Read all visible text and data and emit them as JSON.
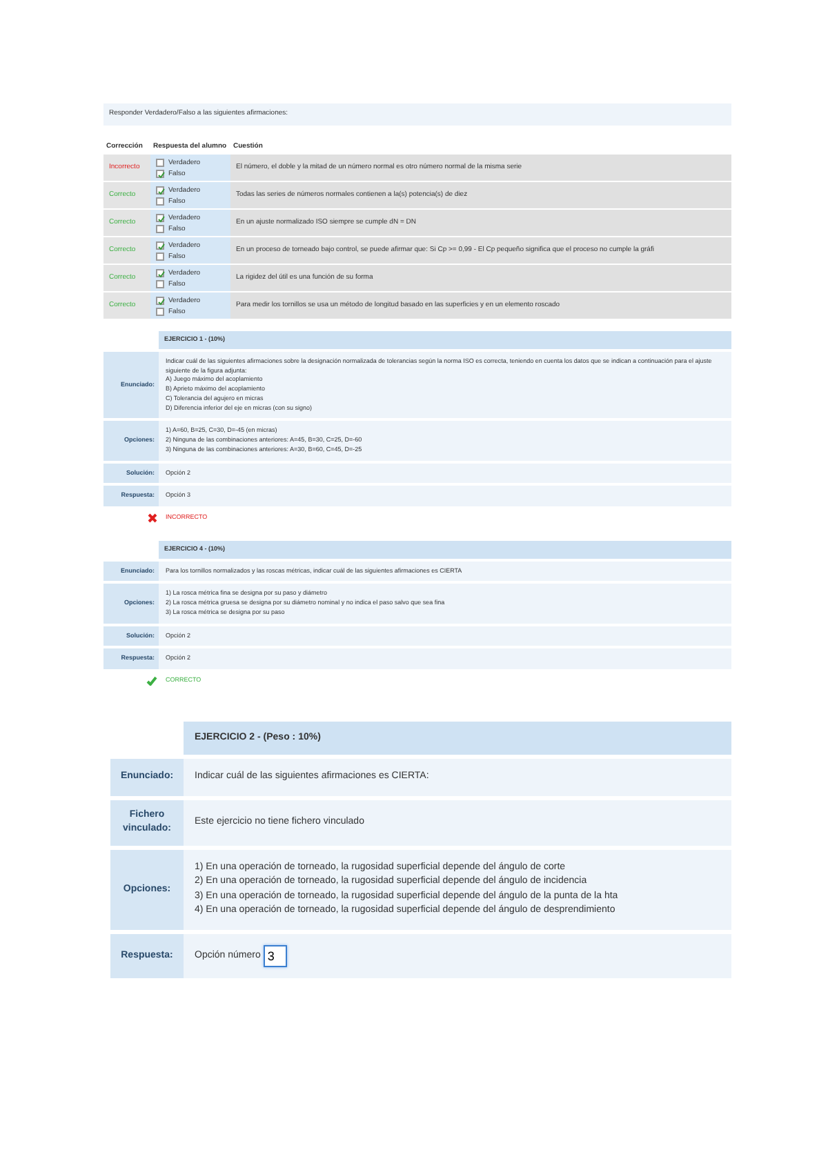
{
  "instruction": "Responder Verdadero/Falso a las siguientes afirmaciones:",
  "tf_table": {
    "columns": [
      "Corrección",
      "Respuesta del alumno",
      "Cuestión"
    ],
    "rows": [
      {
        "correction": "Incorrecto",
        "correct": false,
        "options": [
          {
            "label": "Verdadero",
            "checked": false
          },
          {
            "label": "Falso",
            "checked": true
          }
        ],
        "question": "El número, el doble y la mitad de un número normal es otro número normal de la misma serie"
      },
      {
        "correction": "Correcto",
        "correct": true,
        "options": [
          {
            "label": "Verdadero",
            "checked": true
          },
          {
            "label": "Falso",
            "checked": false
          }
        ],
        "question": "Todas las series de números normales contienen a la(s) potencia(s) de diez"
      },
      {
        "correction": "Correcto",
        "correct": true,
        "options": [
          {
            "label": "Verdadero",
            "checked": true
          },
          {
            "label": "Falso",
            "checked": false
          }
        ],
        "question": "En un ajuste normalizado ISO siempre se cumple dN = DN"
      },
      {
        "correction": "Correcto",
        "correct": true,
        "options": [
          {
            "label": "Verdadero",
            "checked": true
          },
          {
            "label": "Falso",
            "checked": false
          }
        ],
        "question": "En un proceso de torneado bajo control, se puede afirmar que: Si Cp >= 0,99 - El Cp pequeño significa que el proceso no cumple la gráfi"
      },
      {
        "correction": "Correcto",
        "correct": true,
        "options": [
          {
            "label": "Verdadero",
            "checked": true
          },
          {
            "label": "Falso",
            "checked": false
          }
        ],
        "question": "La rigidez del útil es una función de su forma"
      },
      {
        "correction": "Correcto",
        "correct": true,
        "options": [
          {
            "label": "Verdadero",
            "checked": true
          },
          {
            "label": "Falso",
            "checked": false
          }
        ],
        "question": "Para medir los tornillos se usa un método de longitud basado en las superficies y en un elemento roscado"
      }
    ]
  },
  "exercises": [
    {
      "kind": "review",
      "title": "EJERCICIO 1 - (10%)",
      "fields": [
        {
          "label": "Enunciado:",
          "kind": "text",
          "lines": [
            "Indicar cuál de las siguientes afirmaciones sobre la designación normalizada de tolerancias según la norma ISO es correcta, teniendo en cuenta los datos que se indican a continuación para el ajuste",
            "siguiente de la figura adjunta:",
            "A) Juego máximo del acoplamiento",
            "B) Aprieto máximo del acoplamiento",
            "C) Tolerancia del agujero en micras",
            "D) Diferencia inferior del eje en micras (con su signo)"
          ]
        },
        {
          "label": "Opciones:",
          "kind": "text",
          "lines": [
            "1) A=60, B=25, C=30, D=-45 (en micras)",
            "2) Ninguna de las combinaciones anteriores: A=45, B=30, C=25, D=-60",
            "3) Ninguna de las combinaciones anteriores: A=30, B=60, C=45, D=-25"
          ]
        },
        {
          "label": "Solución:",
          "kind": "text",
          "lines": [
            "Opción 2"
          ]
        },
        {
          "label": "Respuesta:",
          "kind": "text",
          "lines": [
            "Opción 3"
          ]
        }
      ],
      "result": {
        "text": "INCORRECTO",
        "correct": false
      }
    },
    {
      "kind": "review",
      "title": "EJERCICIO 4 - (10%)",
      "fields": [
        {
          "label": "Enunciado:",
          "kind": "text",
          "lines": [
            "Para los tornillos normalizados y las roscas métricas, indicar cuál de las siguientes afirmaciones es CIERTA"
          ]
        },
        {
          "label": "Opciones:",
          "kind": "text",
          "lines": [
            "1) La rosca métrica fina se designa por su paso y diámetro",
            "2) La rosca métrica gruesa se designa por su diámetro nominal y no indica el paso salvo que sea fina",
            "3) La rosca métrica se designa por su paso"
          ]
        },
        {
          "label": "Solución:",
          "kind": "text",
          "lines": [
            "Opción 2"
          ]
        },
        {
          "label": "Respuesta:",
          "kind": "text",
          "lines": [
            "Opción 2"
          ]
        }
      ],
      "result": {
        "text": "CORRECTO",
        "correct": true
      }
    },
    {
      "kind": "answer",
      "title": "EJERCICIO 2 - (Peso : 10%)",
      "fields": [
        {
          "label": "Enunciado:",
          "kind": "text",
          "lines": [
            "Indicar cuál de las siguientes afirmaciones es CIERTA:"
          ]
        },
        {
          "label": "Fichero vinculado:",
          "kind": "text",
          "lines": [
            "Este ejercicio no tiene fichero vinculado"
          ]
        },
        {
          "label": "Opciones:",
          "kind": "text",
          "lines": [
            "1) En una operación de torneado, la rugosidad superficial depende del ángulo de corte",
            "2) En una operación de torneado, la rugosidad superficial depende del ángulo de incidencia",
            "3) En una operación de torneado, la rugosidad superficial depende del ángulo de la punta de la hta",
            "4) En una operación de torneado, la rugosidad superficial depende del ángulo de desprendimiento"
          ]
        },
        {
          "label": "Respuesta:",
          "kind": "input",
          "prefix": "Opción número",
          "value": "3"
        }
      ]
    }
  ]
}
